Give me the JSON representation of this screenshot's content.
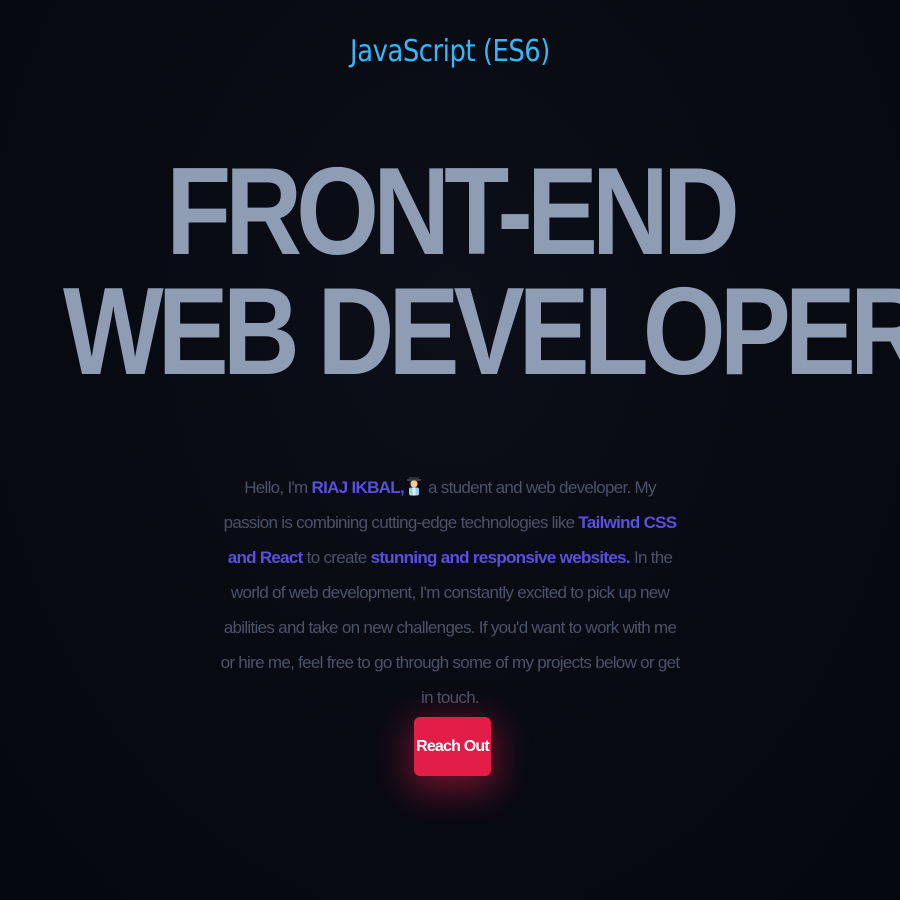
{
  "hero": {
    "tagline": "JavaScript (ES6)",
    "headline_line1": "FRONT-END",
    "headline_line2": "WEB DEVELOPER.",
    "intro": {
      "greeting": "Hello, I'm",
      "name": "RIAJ IKBAL,",
      "student_icon": "student-emoji-icon",
      "part1": "a student and web developer. My passion is combining cutting-edge technologies like",
      "tech": "Tailwind CSS and React",
      "part2": "to create",
      "highlight": "stunning and responsive websites.",
      "part3": "In the world of web development, I'm constantly excited to pick up new abilities and take on new challenges. If you'd want to work with me or hire me, feel free to go through some of my projects below or get in touch."
    },
    "cta_label": "Reach Out"
  },
  "colors": {
    "background": "#080a12",
    "tagline": "#38b6f5",
    "headline": "#8f9db4",
    "body_text": "#4b5366",
    "highlight": "#5b4fe0",
    "cta": "#e11d48"
  }
}
